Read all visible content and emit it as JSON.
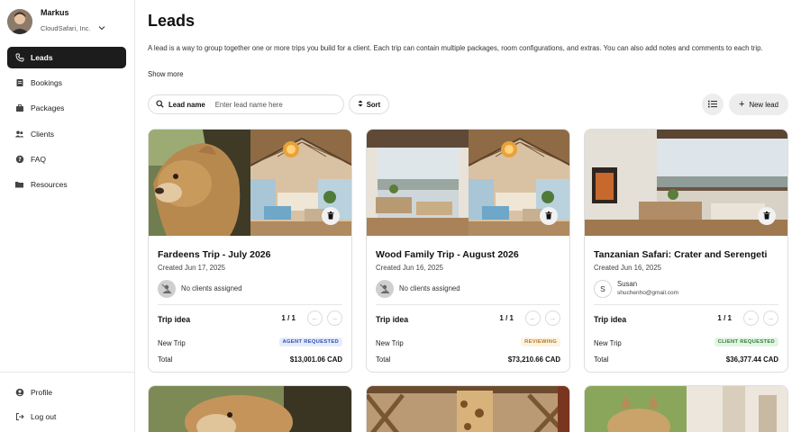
{
  "account": {
    "name": "Markus",
    "org": "CloudSafari, Inc."
  },
  "nav": {
    "items": [
      {
        "label": "Leads",
        "icon": "phone-icon",
        "active": true
      },
      {
        "label": "Bookings",
        "icon": "book-icon",
        "active": false
      },
      {
        "label": "Packages",
        "icon": "briefcase-icon",
        "active": false
      },
      {
        "label": "Clients",
        "icon": "users-icon",
        "active": false
      },
      {
        "label": "FAQ",
        "icon": "question-icon",
        "active": false
      },
      {
        "label": "Resources",
        "icon": "folder-icon",
        "active": false
      }
    ],
    "bottom": [
      {
        "label": "Profile",
        "icon": "profile-icon"
      },
      {
        "label": "Log out",
        "icon": "logout-icon"
      }
    ]
  },
  "main": {
    "title": "Leads",
    "description": "A lead is a way to group together one or more trips you build for a client. Each trip can contain multiple packages, room configurations, and extras. You can also add notes and comments to each trip.",
    "show_more": "Show more",
    "search": {
      "label": "Lead name",
      "placeholder": "Enter lead name here"
    },
    "sort_label": "Sort",
    "new_lead_label": "New lead"
  },
  "cards": [
    {
      "title": "Fardeens Trip - July 2026",
      "created": "Created Jun 17, 2025",
      "client_text": "No clients assigned",
      "client_email": "",
      "trip_label": "Trip idea",
      "pager": "1 / 1",
      "trip_name": "New Trip",
      "status": "AGENT REQUESTED",
      "status_color": "#2f4fb3",
      "status_bg": "#e6ecfb",
      "total_label": "Total",
      "total": "$13,001.06 CAD"
    },
    {
      "title": "Wood Family Trip - August 2026",
      "created": "Created Jun 16, 2025",
      "client_text": "No clients assigned",
      "client_email": "",
      "trip_label": "Trip idea",
      "pager": "1 / 1",
      "trip_name": "New Trip",
      "status": "REVIEWING",
      "status_color": "#b7791f",
      "status_bg": "#fdf3e1",
      "total_label": "Total",
      "total": "$73,210.66 CAD"
    },
    {
      "title": "Tanzanian Safari: Crater and Serengeti",
      "created": "Created Jun 16, 2025",
      "client_text": "Susan",
      "client_initial": "S",
      "client_email": "shuchenho@gmail.com",
      "trip_label": "Trip idea",
      "pager": "1 / 1",
      "trip_name": "New Trip",
      "status": "CLIENT REQUESTED",
      "status_color": "#2f7d3a",
      "status_bg": "#e3f5e3",
      "total_label": "Total",
      "total": "$36,377.44 CAD"
    }
  ]
}
